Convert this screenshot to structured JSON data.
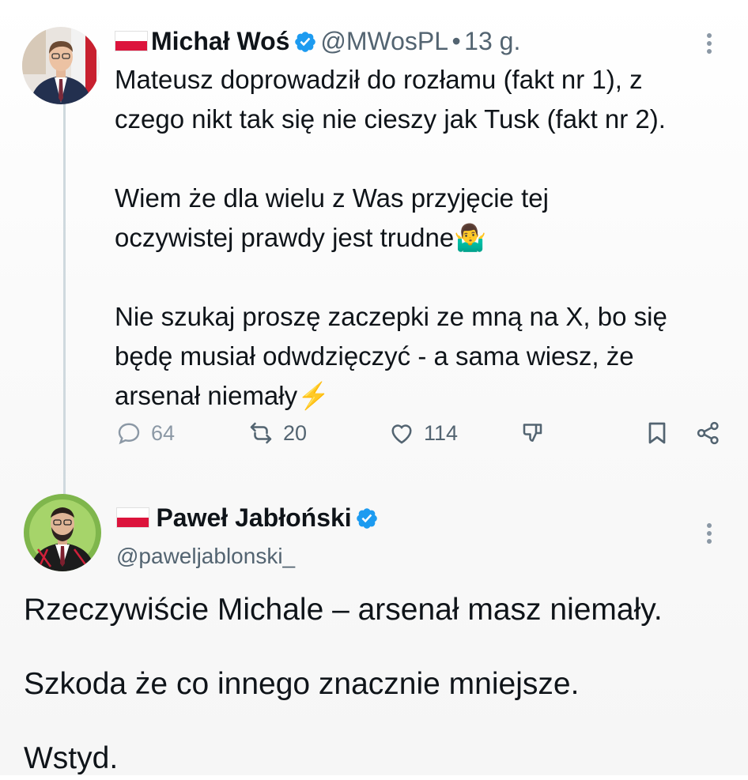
{
  "tweet1": {
    "name": "Michał Woś",
    "handle": "@MWosPL",
    "separator": "•",
    "time": "13 g.",
    "lines": [
      "Mateusz doprowadził do rozłamu (fakt nr 1), z",
      "czego nikt tak się nie cieszy jak Tusk (fakt nr 2).",
      "",
      "Wiem że dla wielu z Was przyjęcie tej",
      "oczywistej prawdy jest trudne🤷‍♂️",
      "",
      "Nie szukaj proszę zaczepki ze mną na X, bo się",
      "będę musiał odwdzięczyć - a sama wiesz, że",
      "arsenał niemały⚡"
    ],
    "replies_count": "64",
    "reposts_count": "20",
    "likes_count": "114"
  },
  "tweet2": {
    "name": "Paweł Jabłoński",
    "handle": "@paweljablonski_",
    "paragraphs": [
      "Rzeczywiście Michale – arsenał masz niemały.",
      "Szkoda że co innego znacznie mniejsze.",
      "Wstyd."
    ]
  },
  "colors": {
    "verified": "#1d9bf0",
    "muted": "#536471",
    "flag_red": "#dc143c"
  }
}
